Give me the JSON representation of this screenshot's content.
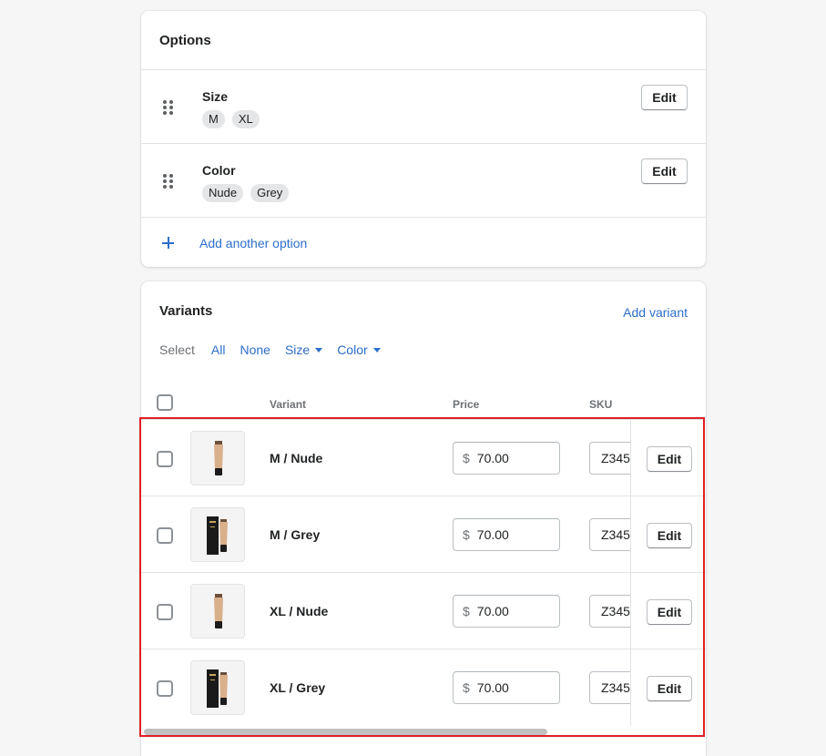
{
  "options": {
    "title": "Options",
    "items": [
      {
        "name": "Size",
        "values": [
          "M",
          "XL"
        ],
        "edit_label": "Edit"
      },
      {
        "name": "Color",
        "values": [
          "Nude",
          "Grey"
        ],
        "edit_label": "Edit"
      }
    ],
    "add_label": "Add another option"
  },
  "variants": {
    "title": "Variants",
    "add_label": "Add variant",
    "select": {
      "label": "Select",
      "all": "All",
      "none": "None",
      "size": "Size",
      "color": "Color"
    },
    "columns": {
      "variant": "Variant",
      "price": "Price",
      "sku": "SKU"
    },
    "rows": [
      {
        "name": "M / Nude",
        "currency": "$",
        "price": "70.00",
        "sku": "Z345",
        "edit_label": "Edit",
        "image": "nude-tube"
      },
      {
        "name": "M / Grey",
        "currency": "$",
        "price": "70.00",
        "sku": "Z345",
        "edit_label": "Edit",
        "image": "grey-box-tube"
      },
      {
        "name": "XL / Nude",
        "currency": "$",
        "price": "70.00",
        "sku": "Z345",
        "edit_label": "Edit",
        "image": "nude-tube"
      },
      {
        "name": "XL / Grey",
        "currency": "$",
        "price": "70.00",
        "sku": "Z345",
        "edit_label": "Edit",
        "image": "grey-box-tube"
      }
    ]
  },
  "colors": {
    "link": "#2c6ecb",
    "highlight": "#e01f26",
    "tube": "#d9b08c"
  }
}
